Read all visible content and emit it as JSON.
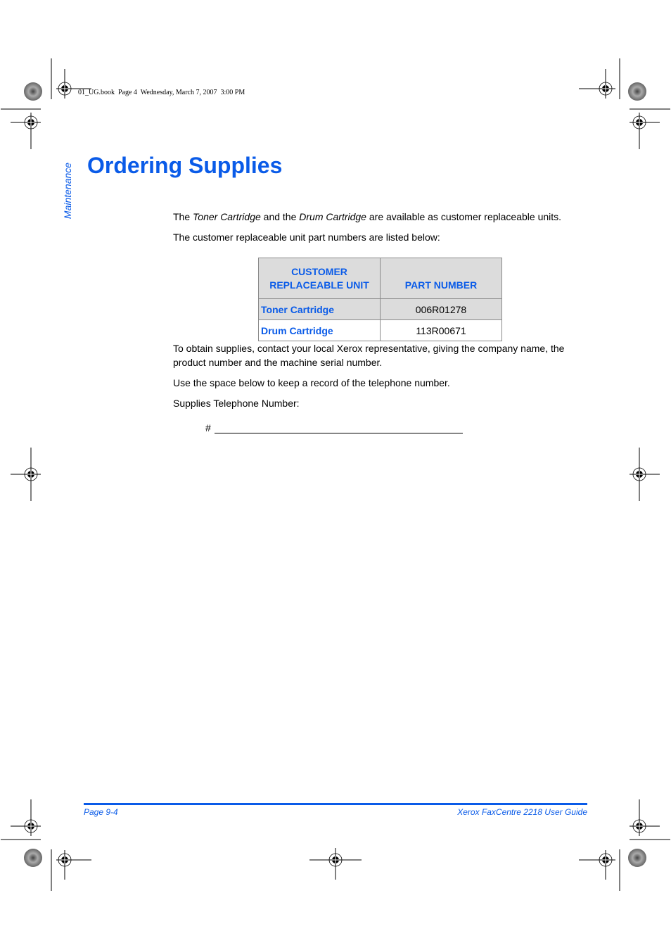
{
  "print_slug": "01_UG.book  Page 4  Wednesday, March 7, 2007  3:00 PM",
  "side_tab": "Maintenance",
  "page_title": "Ordering Supplies",
  "intro": {
    "before": "The ",
    "em1": "Toner Cartridge",
    "middle": " and the ",
    "em2": "Drum Cartridge",
    "after": " are available as customer replaceable units."
  },
  "list_intro": "The customer replaceable unit part numbers are listed below:",
  "table": {
    "headers": [
      "CUSTOMER REPLACEABLE UNIT",
      "PART NUMBER"
    ],
    "header_lines": [
      "CUSTOMER",
      "REPLACEABLE UNIT"
    ],
    "rows": [
      {
        "unit": "Toner Cartridge",
        "part_number": "006R01278"
      },
      {
        "unit": "Drum Cartridge",
        "part_number": "113R00671"
      }
    ]
  },
  "obtain_text": "To obtain supplies, contact your local Xerox representative, giving the company name, the product number and the machine serial number.",
  "record_text": "Use the space below to keep a record of the telephone number.",
  "telephone_label": "Supplies Telephone Number:",
  "telephone_prefix": "#",
  "telephone_value": "",
  "footer": {
    "page": "Page 9-4",
    "guide": "Xerox FaxCentre 2218 User Guide"
  },
  "colors": {
    "accent": "#0a5be8",
    "table_shade": "#dcdcdc"
  }
}
